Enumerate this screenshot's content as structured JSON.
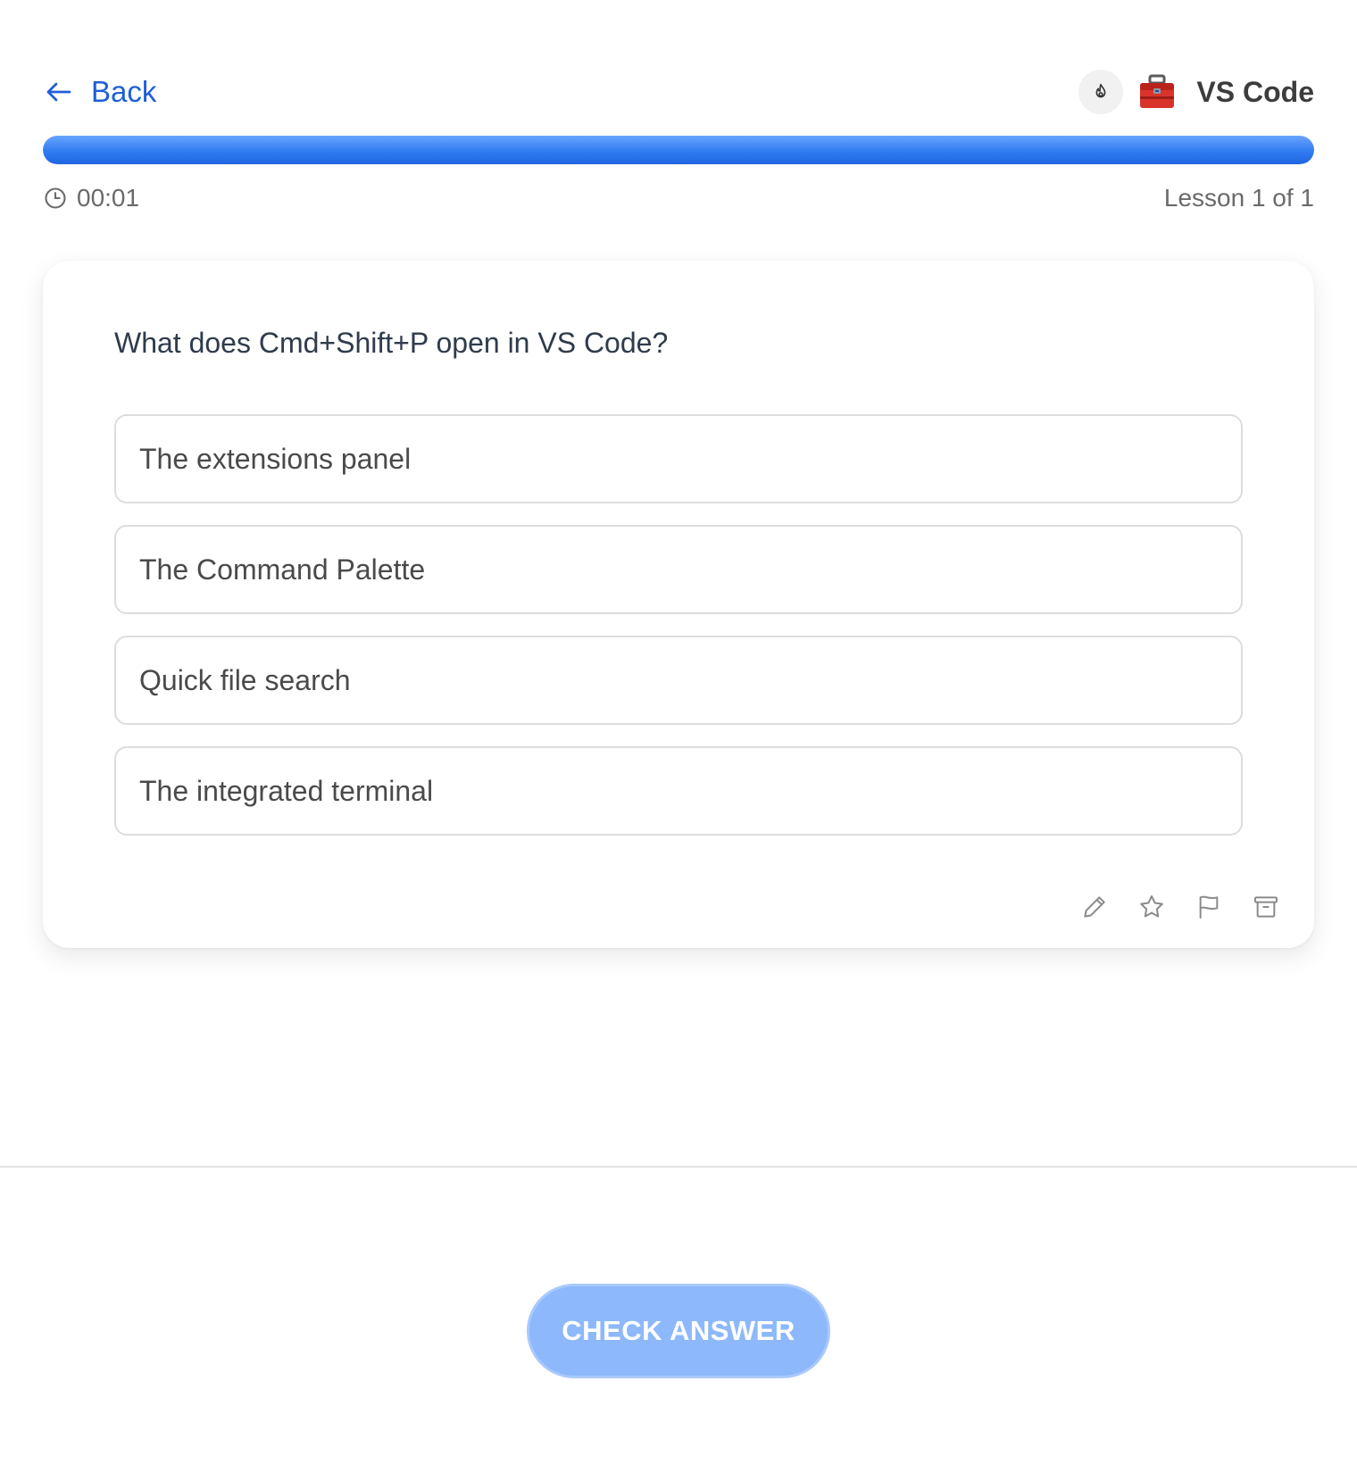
{
  "header": {
    "back_label": "Back",
    "deck_title": "VS Code",
    "icons": {
      "back": "arrow-left-icon",
      "streak": "fire-icon",
      "deck": "toolbox-icon"
    }
  },
  "progress": {
    "fraction": 1.0
  },
  "meta": {
    "timer": "00:01",
    "lesson": "Lesson 1 of 1"
  },
  "question": {
    "text": "What does Cmd+Shift+P open in VS Code?",
    "options": [
      "The extensions panel",
      "The Command Palette",
      "Quick file search",
      "The integrated terminal"
    ]
  },
  "card_actions": [
    "pencil-icon",
    "star-icon",
    "flag-icon",
    "archive-icon"
  ],
  "footer": {
    "check_label": "CHECK ANSWER"
  },
  "colors": {
    "accent": "#1f5fd6",
    "progress": "#2f7bf2",
    "button": "#8db8fb"
  }
}
